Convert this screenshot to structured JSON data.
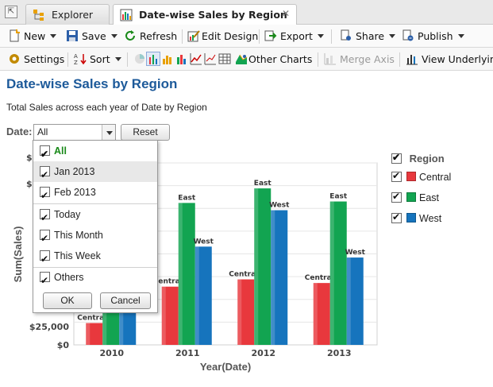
{
  "tabs": {
    "explorer": "Explorer",
    "active": "Date-wise Sales by Region"
  },
  "toolbar1": {
    "new": "New",
    "save": "Save",
    "refresh": "Refresh",
    "edit_design": "Edit Design",
    "export": "Export",
    "share": "Share",
    "publish": "Publish"
  },
  "toolbar2": {
    "settings": "Settings",
    "sort": "Sort",
    "other_charts": "Other Charts",
    "merge_axis": "Merge Axis",
    "view_underlying": "View Underlyin"
  },
  "report": {
    "title": "Date-wise Sales by Region",
    "subtitle": "Total Sales across each year of Date by Region",
    "date_label": "Date:",
    "date_value": "All",
    "reset": "Reset"
  },
  "date_filter": {
    "items": [
      "All",
      "Jan 2013",
      "Feb 2013",
      "Today",
      "This Month",
      "This Week",
      "Others"
    ],
    "ok": "OK",
    "cancel": "Cancel"
  },
  "legend": {
    "title": "Region"
  },
  "chart_data": {
    "type": "bar",
    "categories": [
      "2010",
      "2011",
      "2012",
      "2013"
    ],
    "series": [
      {
        "name": "Central",
        "color": "#e8383d",
        "values": [
          30000,
          80000,
          90000,
          85000
        ]
      },
      {
        "name": "East",
        "color": "#12a451",
        "values": [
          65000,
          195000,
          215000,
          197000
        ]
      },
      {
        "name": "West",
        "color": "#1674bd",
        "values": [
          45000,
          135000,
          185000,
          120000
        ]
      }
    ],
    "xlabel": "Year(Date)",
    "ylabel": "Sum(Sales)",
    "yticks": [
      "$0",
      "$25,000"
    ],
    "ylim": [
      0,
      250000
    ],
    "legend_position": "right",
    "grid": true
  }
}
